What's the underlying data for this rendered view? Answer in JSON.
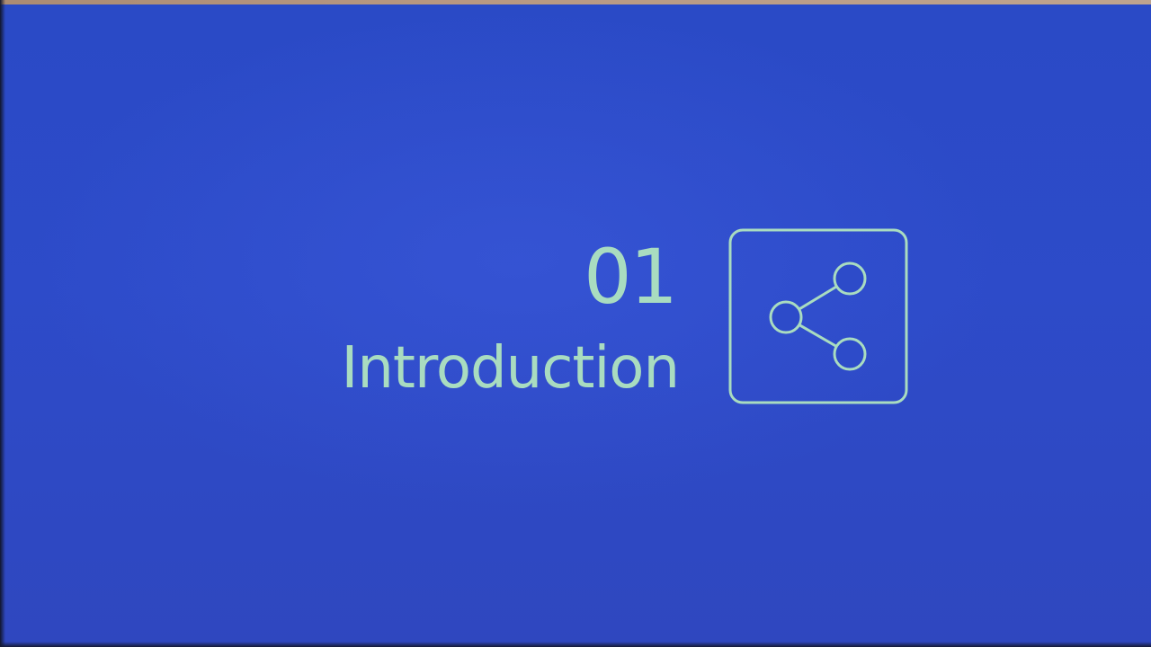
{
  "slide": {
    "section_number": "01",
    "section_title": "Introduction",
    "icon": "share-icon"
  },
  "colors": {
    "background": "#2d4bc9",
    "text": "#a9dcc0",
    "icon_stroke": "#a9dcc0"
  }
}
